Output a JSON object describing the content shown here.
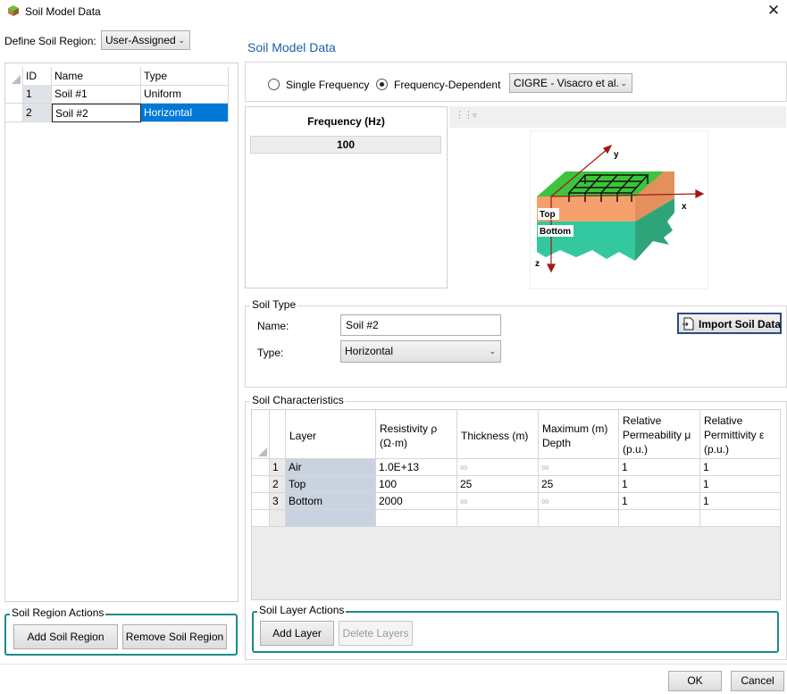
{
  "window": {
    "title": "Soil Model Data",
    "close_glyph": "✕"
  },
  "define_region": {
    "label": "Define Soil Region:",
    "value": "User-Assigned"
  },
  "regions": {
    "headers": [
      "ID",
      "Name",
      "Type"
    ],
    "rows": [
      {
        "id": "1",
        "name": "Soil #1",
        "type": "Uniform"
      },
      {
        "id": "2",
        "name": "Soil #2",
        "type": "Horizontal"
      }
    ]
  },
  "region_actions": {
    "title": "Soil Region Actions",
    "add": "Add Soil Region",
    "remove": "Remove Soil Region"
  },
  "section_title": "Soil Model Data",
  "frequency": {
    "single_label": "Single Frequency",
    "dependent_label": "Frequency-Dependent",
    "model": "CIGRE - Visacro et al.",
    "header": "Frequency (Hz)",
    "value": "100"
  },
  "diagram": {
    "x_label": "x",
    "y_label": "y",
    "z_label": "z",
    "top_label": "Top",
    "bottom_label": "Bottom"
  },
  "soil_type": {
    "title": "Soil Type",
    "name_label": "Name:",
    "name_value": "Soil #2",
    "type_label": "Type:",
    "type_value": "Horizontal",
    "import_label": "Import Soil Data"
  },
  "characteristics": {
    "title": "Soil Characteristics",
    "headers": {
      "layer": "Layer",
      "resistivity_1": "Resistivity ρ",
      "resistivity_2": "(Ω·m)",
      "thickness": "Thickness (m)",
      "maxdepth_1": "Maximum (m)",
      "maxdepth_2": "Depth",
      "perm_1": "Relative",
      "perm_2": "Permeability μ",
      "perm_3": "(p.u.)",
      "permit_1": "Relative",
      "permit_2": "Permittivity ε",
      "permit_3": "(p.u.)"
    },
    "rows": [
      {
        "n": "1",
        "layer": "Air",
        "resistivity": "1.0E+13",
        "thickness": "∞",
        "depth": "∞",
        "mu": "1",
        "eps": "1"
      },
      {
        "n": "2",
        "layer": "Top",
        "resistivity": "100",
        "thickness": "25",
        "depth": "25",
        "mu": "1",
        "eps": "1"
      },
      {
        "n": "3",
        "layer": "Bottom",
        "resistivity": "2000",
        "thickness": "∞",
        "depth": "∞",
        "mu": "1",
        "eps": "1"
      }
    ]
  },
  "layer_actions": {
    "title": "Soil Layer Actions",
    "add": "Add Layer",
    "delete": "Delete Layers"
  },
  "footer": {
    "ok": "OK",
    "cancel": "Cancel"
  },
  "colors": {
    "accent": "#0078d7",
    "section_title": "#1e5fa8",
    "teal_border": "#1a8c8c"
  }
}
